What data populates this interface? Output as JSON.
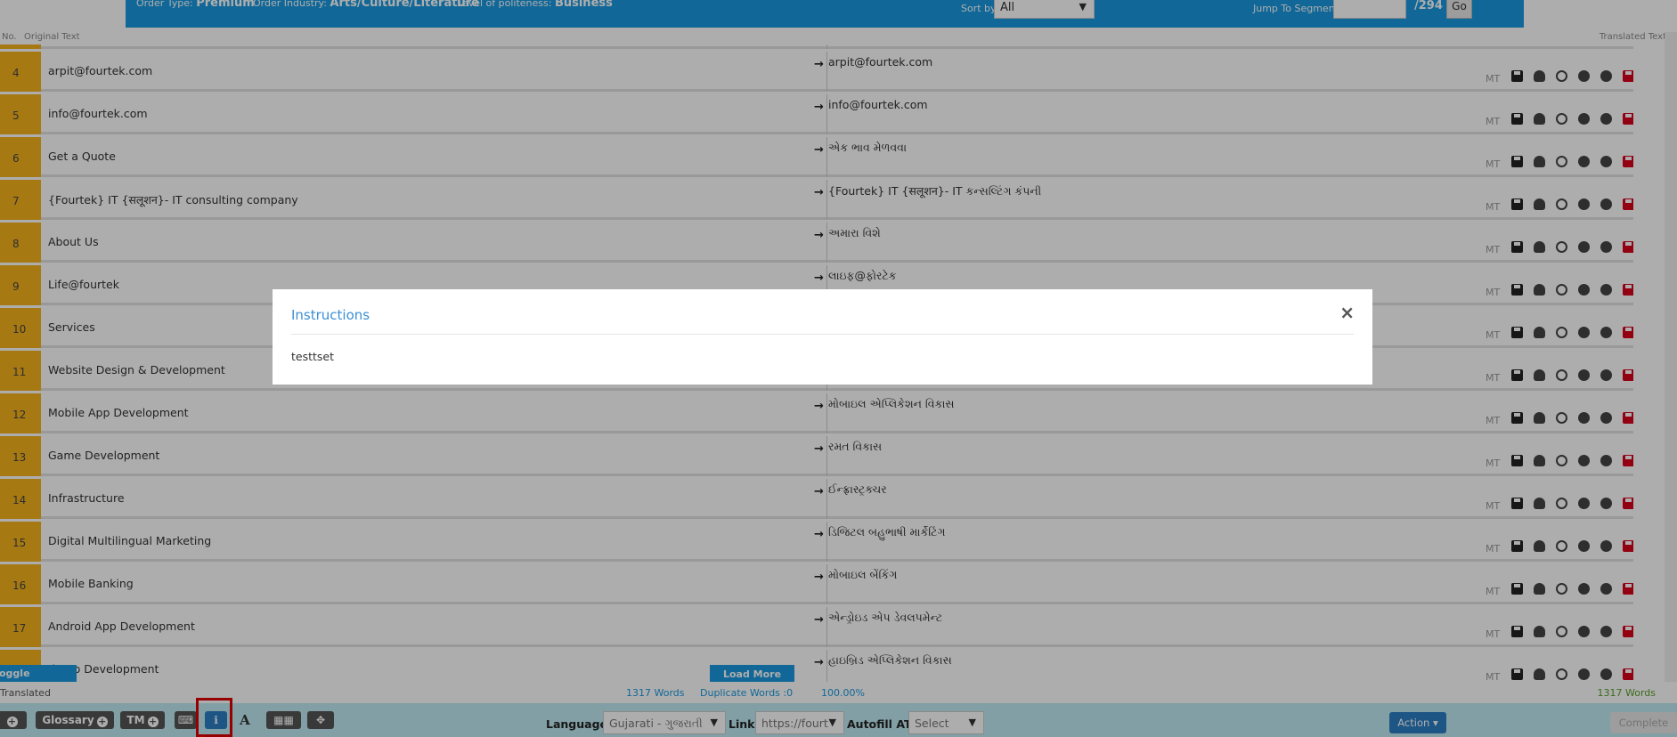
{
  "header": {
    "order_type_label": "Order Type:",
    "order_type_value": "Premium",
    "order_industry_label": "Order Industry:",
    "order_industry_value": "Arts/Culture/Literature",
    "politeness_label": "Level of politeness:",
    "politeness_value": "Business",
    "sort_by_label": "Sort by",
    "sort_by_value": "All",
    "jump_label": "Jump To Segment",
    "jump_total": "/294",
    "go_label": "Go"
  },
  "columns": {
    "no": "No.",
    "original": "Original Text",
    "translated": "Translated Text"
  },
  "rows": [
    {
      "num": "",
      "source": "",
      "target": ""
    },
    {
      "num": "4",
      "source": "arpit@fourtek.com",
      "target": "arpit@fourtek.com"
    },
    {
      "num": "5",
      "source": "info@fourtek.com",
      "target": "info@fourtek.com"
    },
    {
      "num": "6",
      "source": "Get a Quote",
      "target": "એક ભાવ મેળવવા"
    },
    {
      "num": "7",
      "source": "{Fourtek} IT {सलूशन}- IT consulting company",
      "target": "{Fourtek} IT {सलूशन}- IT કન્સલ્ટિંગ કંપની"
    },
    {
      "num": "8",
      "source": "About Us",
      "target": "અમારા વિશે"
    },
    {
      "num": "9",
      "source": "Life@fourtek",
      "target": "લાઇફ@ફોરટેક"
    },
    {
      "num": "10",
      "source": "Services",
      "target": ""
    },
    {
      "num": "11",
      "source": "Website Design & Development",
      "target": ""
    },
    {
      "num": "12",
      "source": "Mobile App Development",
      "target": "મોબાઇલ એપ્લિકેશન વિકાસ"
    },
    {
      "num": "13",
      "source": "Game Development",
      "target": "રમત વિકાસ"
    },
    {
      "num": "14",
      "source": "Infrastructure",
      "target": "ઈન્ફ્રાસ્ટ્રક્ચર"
    },
    {
      "num": "15",
      "source": "Digital Multilingual Marketing",
      "target": "ડિજિટલ બહુભાષી માર્કેટિંગ"
    },
    {
      "num": "16",
      "source": "Mobile Banking",
      "target": "મોબાઇલ બેંકિંગ"
    },
    {
      "num": "17",
      "source": "Android App Development",
      "target": "એન્ડ્રોઇડ એપ ડેવલપમેન્ટ"
    },
    {
      "num": "",
      "source": "d App Development",
      "target": "હાઇબ્રિડ એપ્લિકેશન વિકાસ"
    }
  ],
  "mt_label": "MT",
  "modal": {
    "title": "Instructions",
    "close": "×",
    "body": "testtset"
  },
  "bottom": {
    "load_more": "Load More",
    "toggle_controls": "oggle Controls",
    "translated": "Translated",
    "words": "1317 Words",
    "duplicate": "Duplicate Words :0",
    "percent": "100.00%",
    "right_words": "1317 Words"
  },
  "toolbar": {
    "glossary": "Glossary",
    "tm": "TM",
    "language_label": "Language",
    "language_value": "Gujarati - ગુજરાતી",
    "link_label": "Link",
    "link_value": "https://fourt",
    "autofill_label": "Autofill AT",
    "autofill_value": "Select",
    "action": "Action",
    "complete": "Complete"
  },
  "colors": {
    "brand_blue": "#1a9ae0",
    "segment_number_bg": "#f5b31d",
    "toolbar_bg": "#bfeaf2",
    "delete_red": "#d9001b"
  }
}
